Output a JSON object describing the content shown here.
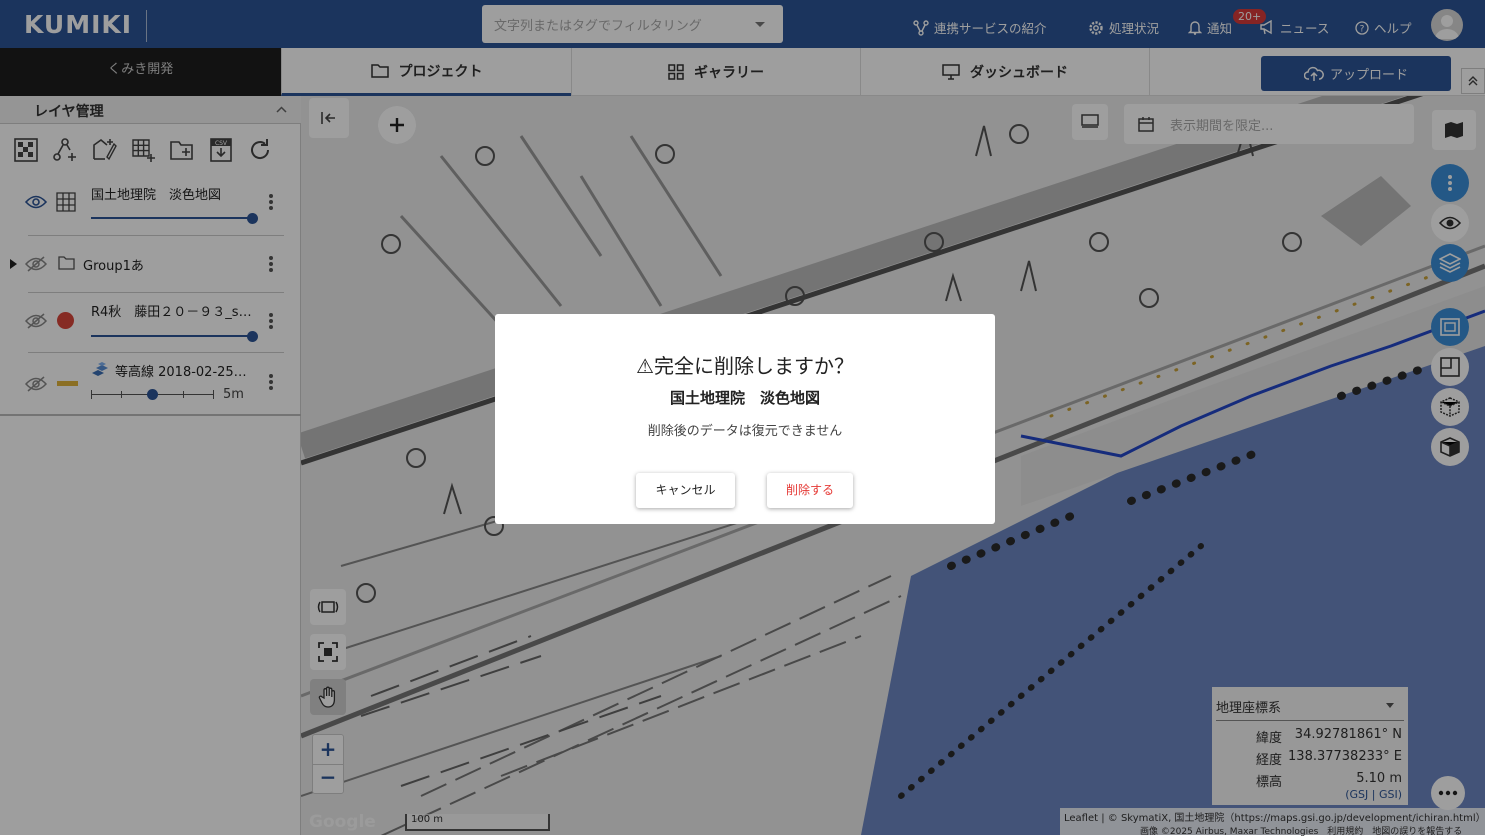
{
  "header": {
    "logo": "KUMIKI",
    "filter_placeholder": "文字列またはタグでフィルタリング",
    "nav": {
      "integrations": "連携サービスの紹介",
      "processing": "処理状況",
      "notifications": "通知",
      "notifications_badge": "20+",
      "news": "ニュース",
      "help": "ヘルプ"
    }
  },
  "subnav": {
    "workspace": "くみき開発",
    "tabs": [
      "プロジェクト",
      "ギャラリー",
      "ダッシュボード"
    ],
    "active_tab": 0,
    "upload": "アップロード"
  },
  "sidebar": {
    "title": "レイヤ管理",
    "layers": [
      {
        "name": "国土地理院　淡色地図",
        "visible": true,
        "type": "tile",
        "opacity": 1.0
      },
      {
        "name": "Group1あ",
        "visible": false,
        "type": "folder"
      },
      {
        "name": "R4秋　藤田２０－９３_s…",
        "visible": false,
        "type": "point",
        "color": "#d9463b",
        "opacity": 1.0
      },
      {
        "name": "等高線 2018-02-25…",
        "visible": false,
        "type": "line",
        "color": "#e0b43a",
        "interval": "5m"
      }
    ]
  },
  "map": {
    "period_placeholder": "表示期間を限定...",
    "scale": "100 m",
    "watermark": "Google",
    "coords": {
      "system": "地理座標系",
      "lat_label": "緯度",
      "lat": "34.92781861° N",
      "lon_label": "経度",
      "lon": "138.37738233° E",
      "elev_label": "標高",
      "elev": "5.10 m",
      "links": "(GSJ | GSI)"
    },
    "attribution_1": "Leaflet | © SkymatiX, 国土地理院（https://maps.gsi.go.jp/development/ichiran.html）",
    "attribution_2": "画像 ©2025 Airbus, Maxar Technologies　利用規約　地図の誤りを報告する"
  },
  "dialog": {
    "title": "⚠完全に削除しますか？",
    "layer_name": "国土地理院　淡色地図",
    "message": "削除後のデータは復元できません",
    "cancel": "キャンセル",
    "delete": "削除する"
  },
  "colors": {
    "brand": "#2d5596",
    "danger": "#e53935",
    "water": "#6c86c2"
  }
}
